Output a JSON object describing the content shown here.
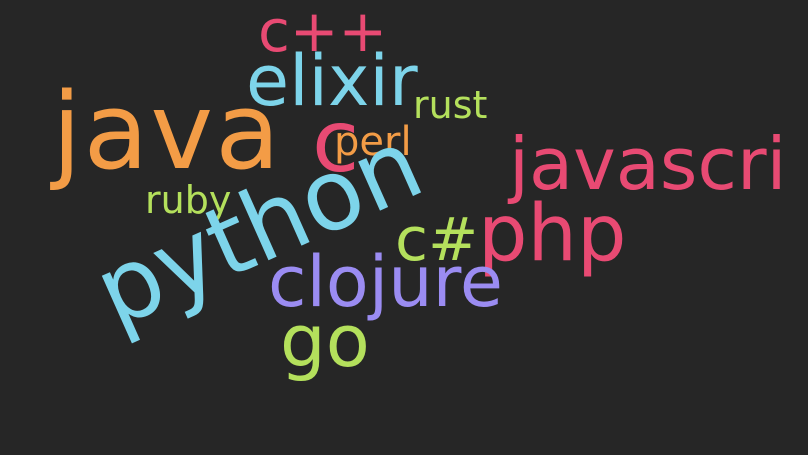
{
  "words": [
    {
      "id": "cpp",
      "text": "c++",
      "color": "#e84a73"
    },
    {
      "id": "elixir",
      "text": "elixir",
      "color": "#7dd4ea"
    },
    {
      "id": "rust",
      "text": "rust",
      "color": "#b4e05c"
    },
    {
      "id": "java",
      "text": "java",
      "color": "#f39c46"
    },
    {
      "id": "c",
      "text": "c",
      "color": "#e84a73"
    },
    {
      "id": "perl",
      "text": "perl",
      "color": "#f39c46"
    },
    {
      "id": "javascri",
      "text": "javascri",
      "color": "#e84a73"
    },
    {
      "id": "ruby",
      "text": "ruby",
      "color": "#b4e05c"
    },
    {
      "id": "python",
      "text": "python",
      "color": "#7dd4ea"
    },
    {
      "id": "csharp",
      "text": "c#",
      "color": "#b4e05c"
    },
    {
      "id": "php",
      "text": "php",
      "color": "#e84a73"
    },
    {
      "id": "clojure",
      "text": "clojure",
      "color": "#9b8cf2"
    },
    {
      "id": "go",
      "text": "go",
      "color": "#b4e05c"
    }
  ],
  "background": "#262626"
}
